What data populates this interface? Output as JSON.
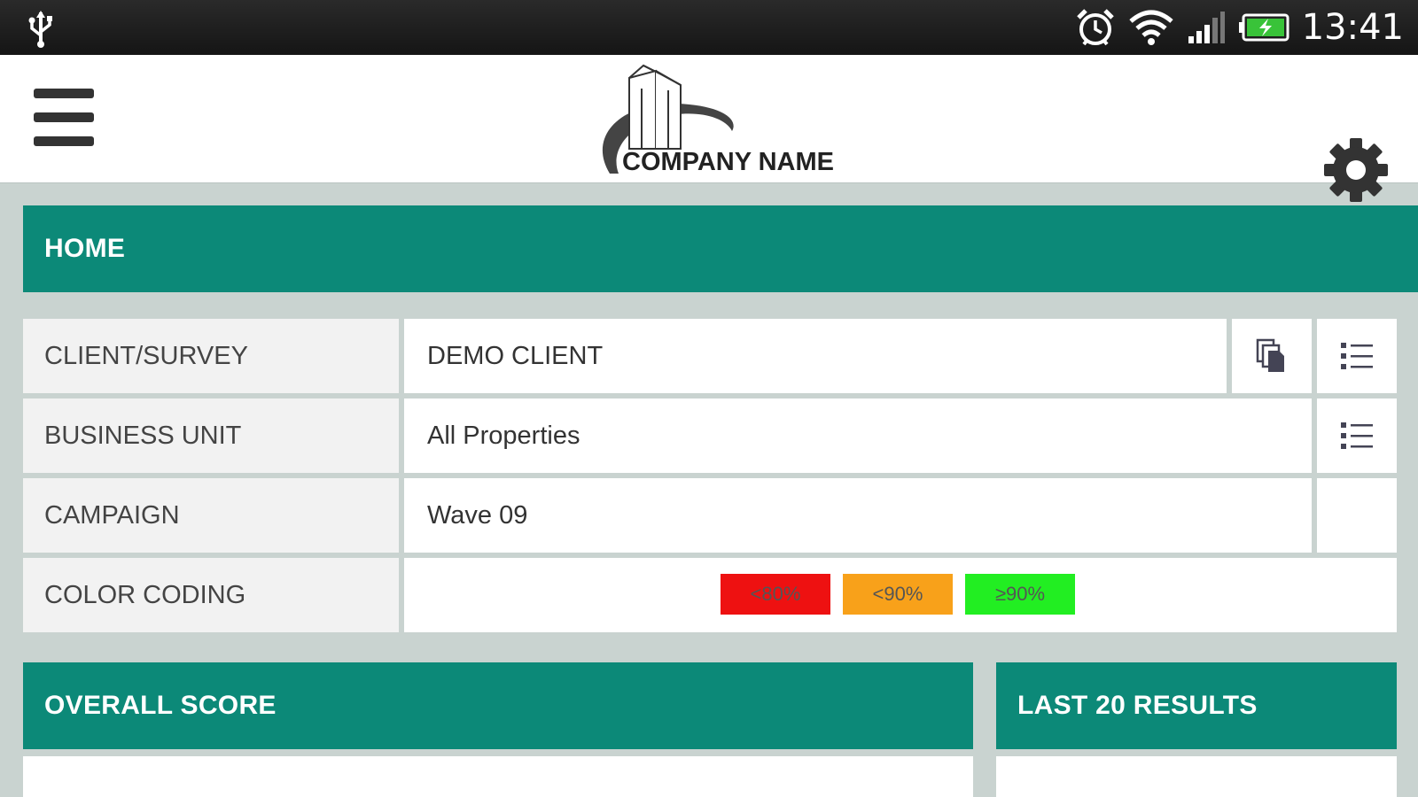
{
  "status_bar": {
    "time": "13:41",
    "icons": [
      "usb-icon",
      "alarm-icon",
      "wifi-icon",
      "signal-icon",
      "battery-charging-icon"
    ]
  },
  "header": {
    "company_name": "COMPANY NAME",
    "icons": [
      "menu-icon",
      "logo-icon",
      "settings-gear-icon"
    ]
  },
  "home": {
    "title": "HOME"
  },
  "filters": [
    {
      "label": "CLIENT/SURVEY",
      "value": "DEMO CLIENT",
      "actions": [
        "copy-icon",
        "list-icon"
      ]
    },
    {
      "label": "BUSINESS UNIT",
      "value": "All Properties",
      "actions": [
        "list-icon"
      ]
    },
    {
      "label": "CAMPAIGN",
      "value": "Wave 09",
      "actions": []
    },
    {
      "label": "COLOR CODING",
      "value": "",
      "actions": []
    }
  ],
  "color_coding": [
    {
      "label": "<80%",
      "color": "#ee1111"
    },
    {
      "label": "<90%",
      "color": "#f8a11a"
    },
    {
      "label": "≥90%",
      "color": "#22ee22"
    }
  ],
  "panels": {
    "overall_score": "OVERALL SCORE",
    "last_results": "LAST 20 RESULTS"
  },
  "colors": {
    "accent": "#0c8978",
    "background": "#c9d3d0",
    "label_bg": "#f2f2f2"
  }
}
